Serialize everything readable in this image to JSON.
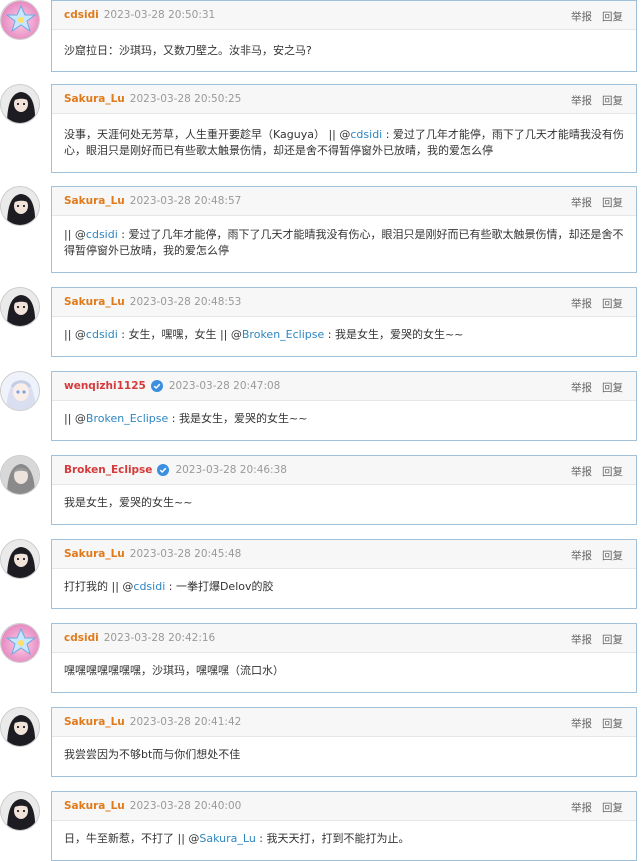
{
  "actions": {
    "report": "举报",
    "reply": "回复"
  },
  "comments": [
    {
      "user": "cdsidi",
      "name_color": "orange",
      "verified": false,
      "avatar": "star",
      "time": "2023-03-28 20:50:31",
      "segments": [
        {
          "text": "沙窟拉日：沙琪玛，又数刀壁之。汝非马，安之马?"
        }
      ]
    },
    {
      "user": "Sakura_Lu",
      "name_color": "orange",
      "verified": false,
      "avatar": "dark",
      "time": "2023-03-28 20:50:25",
      "segments": [
        {
          "text": "没事，天涯何处无芳草，人生重开要趁早（Kaguya）  || @"
        },
        {
          "mention": "cdsidi"
        },
        {
          "text": " : 爱过了几年才能停，雨下了几天才能晴我没有伤心，眼泪只是刚好而已有些歌太触景伤情，却还是舍不得暂停窗外已放晴，我的爱怎么停"
        }
      ]
    },
    {
      "user": "Sakura_Lu",
      "name_color": "orange",
      "verified": false,
      "avatar": "dark",
      "time": "2023-03-28 20:48:57",
      "segments": [
        {
          "text": "|| @"
        },
        {
          "mention": "cdsidi"
        },
        {
          "text": " : 爱过了几年才能停，雨下了几天才能晴我没有伤心，眼泪只是刚好而已有些歌太触景伤情，却还是舍不得暂停窗外已放晴，我的爱怎么停"
        }
      ]
    },
    {
      "user": "Sakura_Lu",
      "name_color": "orange",
      "verified": false,
      "avatar": "dark",
      "time": "2023-03-28 20:48:53",
      "segments": [
        {
          "text": "|| @"
        },
        {
          "mention": "cdsidi"
        },
        {
          "text": " : 女生，嘿嘿，女生 || @"
        },
        {
          "mention": "Broken_Eclipse"
        },
        {
          "text": " : 我是女生，爱哭的女生~~"
        }
      ]
    },
    {
      "user": "wenqizhi1125",
      "name_color": "red",
      "verified": true,
      "avatar": "light",
      "time": "2023-03-28 20:47:08",
      "segments": [
        {
          "text": "|| @"
        },
        {
          "mention": "Broken_Eclipse"
        },
        {
          "text": " : 我是女生，爱哭的女生~~"
        }
      ]
    },
    {
      "user": "Broken_Eclipse",
      "name_color": "red",
      "verified": true,
      "avatar": "grey",
      "time": "2023-03-28 20:46:38",
      "segments": [
        {
          "text": "我是女生，爱哭的女生~~"
        }
      ]
    },
    {
      "user": "Sakura_Lu",
      "name_color": "orange",
      "verified": false,
      "avatar": "dark",
      "time": "2023-03-28 20:45:48",
      "segments": [
        {
          "text": "打打我的 || @"
        },
        {
          "mention": "cdsidi"
        },
        {
          "text": " : 一拳打爆Delov的胶"
        }
      ]
    },
    {
      "user": "cdsidi",
      "name_color": "orange",
      "verified": false,
      "avatar": "star",
      "time": "2023-03-28 20:42:16",
      "segments": [
        {
          "text": "嘿嘿嘿嘿嘿嘿嘿，沙琪玛，嘿嘿嘿（流口水）"
        }
      ]
    },
    {
      "user": "Sakura_Lu",
      "name_color": "orange",
      "verified": false,
      "avatar": "dark",
      "time": "2023-03-28 20:41:42",
      "segments": [
        {
          "text": "我尝尝因为不够bt而与你们想处不佳"
        }
      ]
    },
    {
      "user": "Sakura_Lu",
      "name_color": "orange",
      "verified": false,
      "avatar": "dark",
      "time": "2023-03-28 20:40:00",
      "segments": [
        {
          "text": "日，牛至新惹，不打了 || @"
        },
        {
          "mention": "Sakura_Lu"
        },
        {
          "text": " : 我天天打，打到不能打为止。"
        }
      ]
    }
  ]
}
